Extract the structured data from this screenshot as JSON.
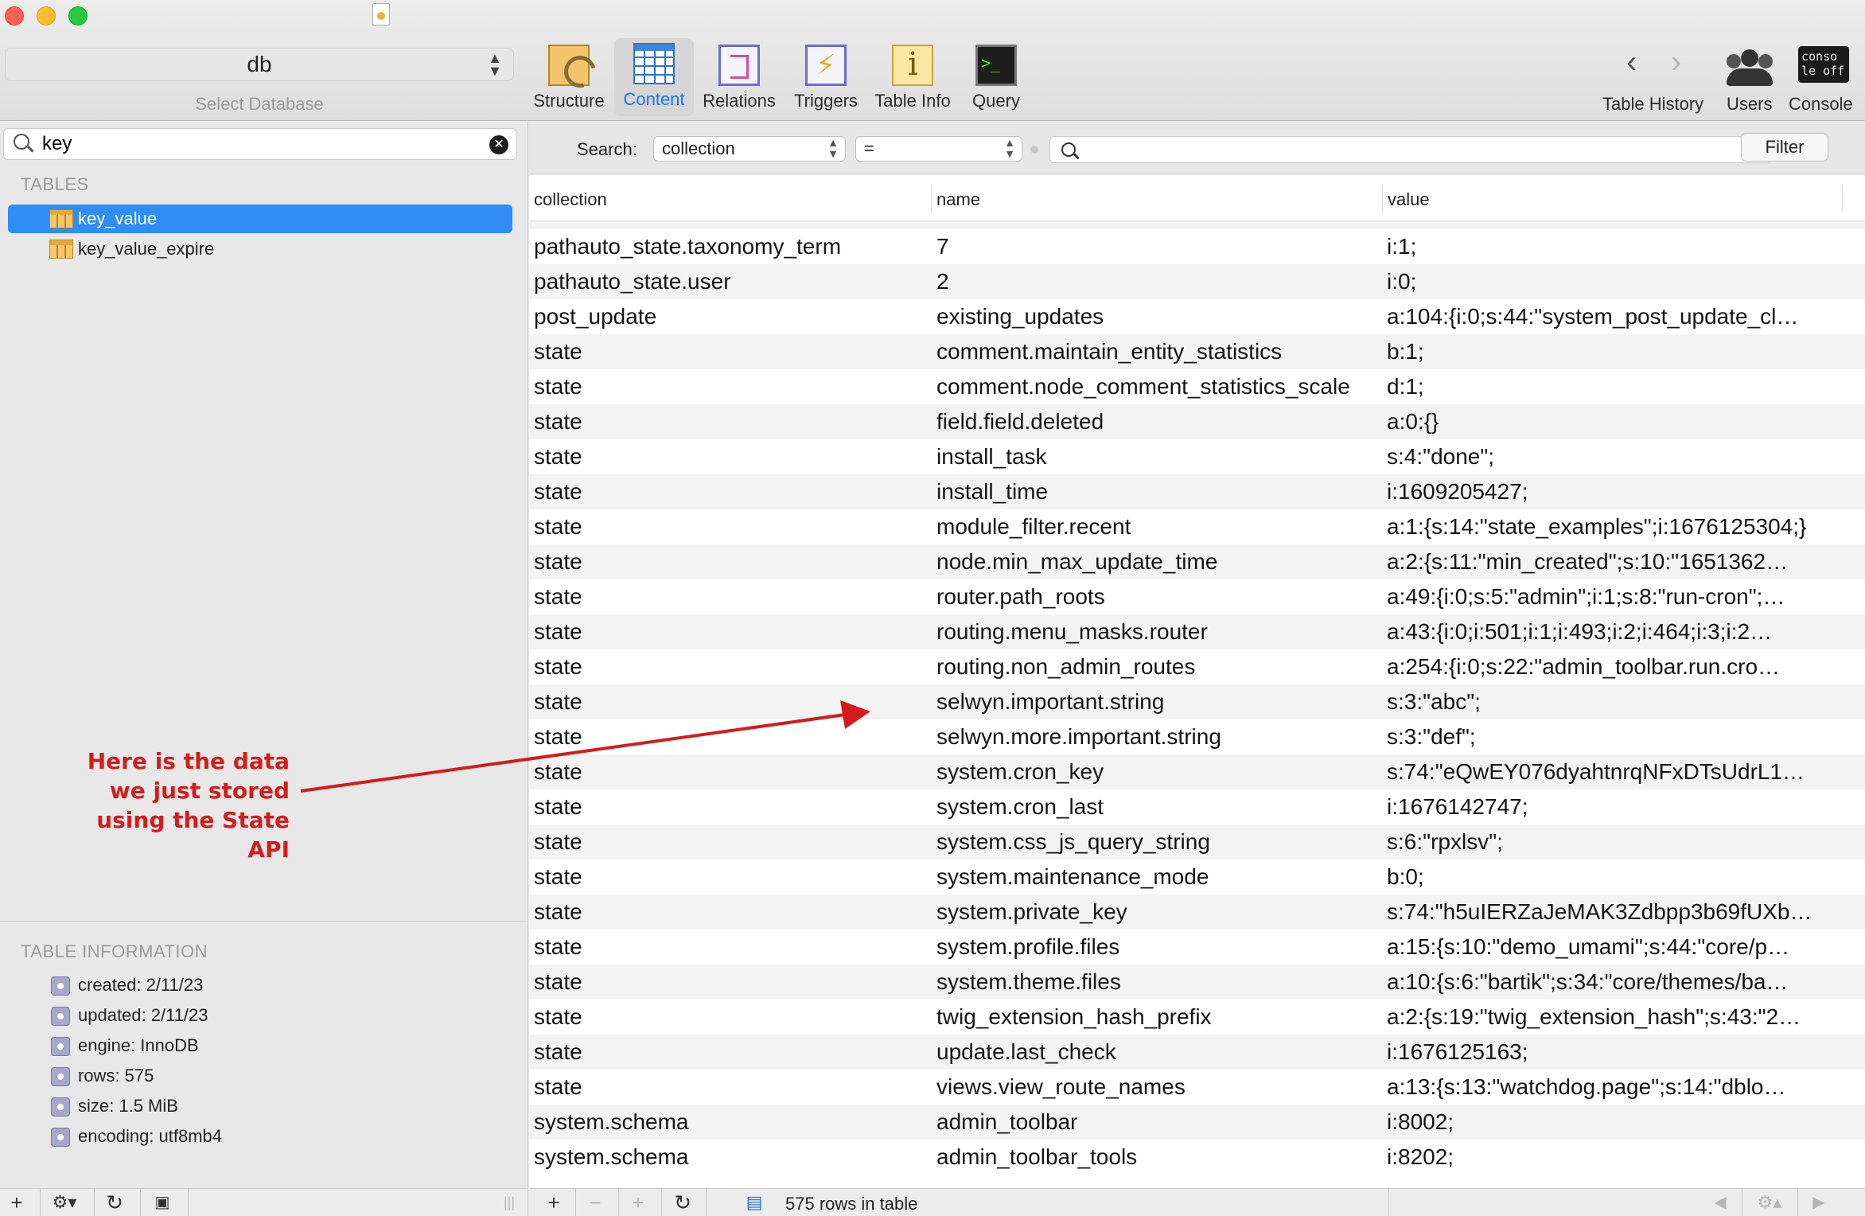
{
  "window": {
    "db_name": "db",
    "db_caption": "Select Database"
  },
  "toolbar": {
    "tools": [
      {
        "label": "Structure"
      },
      {
        "label": "Content"
      },
      {
        "label": "Relations"
      },
      {
        "label": "Triggers"
      },
      {
        "label": "Table Info"
      },
      {
        "label": "Query"
      }
    ],
    "table_history_label": "Table History",
    "users_label": "Users",
    "console_label": "Console",
    "console_icon_text": "conso\nle off",
    "active_color": "#1a75ee"
  },
  "sidebar": {
    "search_value": "key",
    "tables_header": "TABLES",
    "tables": [
      {
        "name": "key_value",
        "selected": true
      },
      {
        "name": "key_value_expire",
        "selected": false
      }
    ],
    "info_header": "TABLE INFORMATION",
    "info": [
      {
        "text": "created: 2/11/23"
      },
      {
        "text": "updated: 2/11/23"
      },
      {
        "text": "engine: InnoDB"
      },
      {
        "text": "rows: 575"
      },
      {
        "text": "size: 1.5 MiB"
      },
      {
        "text": "encoding: utf8mb4"
      }
    ],
    "selection_color": "#2f8df5"
  },
  "annotation": {
    "lines": [
      "Here is the data",
      "we just stored",
      "using the State API"
    ],
    "color": "#d41c1c"
  },
  "filter": {
    "label": "Search:",
    "field": "collection",
    "operator": "=",
    "value": "",
    "button": "Filter"
  },
  "grid": {
    "columns": [
      "collection",
      "name",
      "value"
    ],
    "rows": [
      [
        "pathauto_state.taxonomy_term",
        "7",
        "i:1;"
      ],
      [
        "pathauto_state.user",
        "2",
        "i:0;"
      ],
      [
        "post_update",
        "existing_updates",
        "a:104:{i:0;s:44:\"system_post_update_cl…"
      ],
      [
        "state",
        "comment.maintain_entity_statistics",
        "b:1;"
      ],
      [
        "state",
        "comment.node_comment_statistics_scale",
        "d:1;"
      ],
      [
        "state",
        "field.field.deleted",
        "a:0:{}"
      ],
      [
        "state",
        "install_task",
        "s:4:\"done\";"
      ],
      [
        "state",
        "install_time",
        "i:1609205427;"
      ],
      [
        "state",
        "module_filter.recent",
        "a:1:{s:14:\"state_examples\";i:1676125304;}"
      ],
      [
        "state",
        "node.min_max_update_time",
        "a:2:{s:11:\"min_created\";s:10:\"1651362…"
      ],
      [
        "state",
        "router.path_roots",
        "a:49:{i:0;s:5:\"admin\";i:1;s:8:\"run-cron\";…"
      ],
      [
        "state",
        "routing.menu_masks.router",
        "a:43:{i:0;i:501;i:1;i:493;i:2;i:464;i:3;i:2…"
      ],
      [
        "state",
        "routing.non_admin_routes",
        "a:254:{i:0;s:22:\"admin_toolbar.run.cro…"
      ],
      [
        "state",
        "selwyn.important.string",
        "s:3:\"abc\";"
      ],
      [
        "state",
        "selwyn.more.important.string",
        "s:3:\"def\";"
      ],
      [
        "state",
        "system.cron_key",
        "s:74:\"eQwEY076dyahtnrqNFxDTsUdrL1…"
      ],
      [
        "state",
        "system.cron_last",
        "i:1676142747;"
      ],
      [
        "state",
        "system.css_js_query_string",
        "s:6:\"rpxlsv\";"
      ],
      [
        "state",
        "system.maintenance_mode",
        "b:0;"
      ],
      [
        "state",
        "system.private_key",
        "s:74:\"h5uIERZaJeMAK3Zdbpp3b69fUXb…"
      ],
      [
        "state",
        "system.profile.files",
        "a:15:{s:10:\"demo_umami\";s:44:\"core/p…"
      ],
      [
        "state",
        "system.theme.files",
        "a:10:{s:6:\"bartik\";s:34:\"core/themes/ba…"
      ],
      [
        "state",
        "twig_extension_hash_prefix",
        "a:2:{s:19:\"twig_extension_hash\";s:43:\"2…"
      ],
      [
        "state",
        "update.last_check",
        "i:1676125163;"
      ],
      [
        "state",
        "views.view_route_names",
        "a:13:{s:13:\"watchdog.page\";s:14:\"dblo…"
      ],
      [
        "system.schema",
        "admin_toolbar",
        "i:8002;"
      ],
      [
        "system.schema",
        "admin_toolbar_tools",
        "i:8202;"
      ]
    ]
  },
  "status": {
    "rows_text": "575 rows in table"
  }
}
